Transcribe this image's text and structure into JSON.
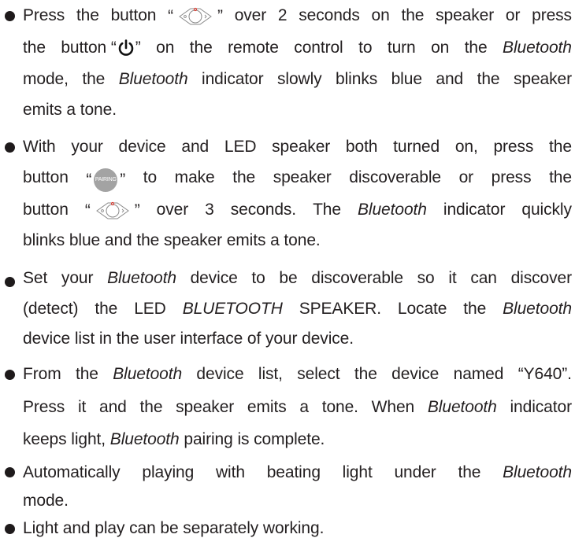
{
  "bullets": [
    {
      "lines": [
        [
          "Press",
          "the",
          "button",
          "“",
          "”",
          "over",
          "2",
          "seconds",
          "on",
          "the",
          "speaker",
          "or",
          "press"
        ],
        [
          "the",
          "button",
          "“",
          "”",
          "on",
          "the",
          "remote",
          "control",
          "to",
          "turn",
          "on",
          "the",
          "Bluetooth"
        ],
        [
          "mode,",
          "the",
          "Bluetooth",
          "indicator",
          "slowly",
          "blinks",
          "blue",
          "and",
          "the",
          "speaker"
        ],
        [
          "emits a tone."
        ]
      ]
    },
    {
      "lines": [
        [
          "With",
          "your",
          "device",
          "and",
          "LED",
          "speaker",
          "both",
          "turned",
          "on,",
          "press",
          "the"
        ],
        [
          "button",
          "“",
          "PAIRING",
          "”",
          "to",
          "make",
          "the",
          "speaker",
          "discoverable",
          "or",
          "press",
          "the"
        ],
        [
          "button",
          "“",
          "”",
          "over",
          "3",
          "seconds.",
          "The",
          "Bluetooth",
          "indicator",
          "quickly"
        ],
        [
          "blinks blue and the speaker emits a tone."
        ]
      ]
    },
    {
      "lines": [
        [
          "Set",
          "your",
          "Bluetooth",
          "device",
          "to",
          "be",
          "discoverable",
          "so",
          "it",
          "can",
          "discover"
        ],
        [
          "(detect)",
          "the",
          "LED",
          "BLUETOOTH",
          "SPEAKER.",
          "Locate",
          "the",
          "Bluetooth"
        ],
        [
          "device list in the user interface of your device."
        ]
      ]
    },
    {
      "lines": [
        [
          "From",
          "the",
          "Bluetooth",
          "device",
          "list,",
          "select",
          "the",
          "device",
          "named",
          "“Y640”."
        ],
        [
          "Press",
          "it",
          "and",
          "the",
          "speaker",
          "emits",
          "a",
          "tone.",
          "When",
          "Bluetooth",
          "indicator"
        ],
        [
          "keeps light,",
          "Bluetooth",
          "pairing is complete."
        ]
      ]
    },
    {
      "lines": [
        [
          "Automatically",
          "playing",
          "with",
          "beating",
          "light",
          "under",
          "the",
          "Bluetooth"
        ],
        [
          "mode."
        ]
      ]
    },
    {
      "lines": [
        [
          "Light and play can be separately working."
        ]
      ]
    }
  ],
  "icons": {
    "mode_button": "mode-button-icon",
    "power": "power-icon",
    "pairing": "pairing-button-icon"
  }
}
